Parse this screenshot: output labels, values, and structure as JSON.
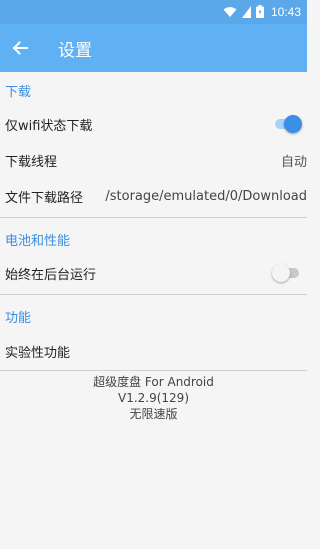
{
  "status_bar": {
    "time": "10:43",
    "icons": [
      "wifi-icon",
      "sim-icon",
      "battery-icon"
    ]
  },
  "app_bar": {
    "title": "设置",
    "back_icon": "arrow-left-icon"
  },
  "sections": {
    "download": {
      "header": "下载",
      "wifi_only": {
        "label": "仅wifi状态下载",
        "toggle_on": true
      },
      "threads": {
        "label": "下载线程",
        "value": "自动"
      },
      "path": {
        "label": "文件下载路径",
        "value": "/storage/emulated/0/Download"
      }
    },
    "battery": {
      "header": "电池和性能",
      "run_background": {
        "label": "始终在后台运行",
        "toggle_on": false
      }
    },
    "features": {
      "header": "功能",
      "experimental": {
        "label": "实验性功能"
      }
    }
  },
  "footer": {
    "app_name": "超级度盘 For Android",
    "version": "V1.2.9(129)",
    "note": "无限速版"
  },
  "colors": {
    "app_bar": "#60b0f4",
    "accent": "#3a8fe6",
    "background": "#f5f5f5"
  }
}
